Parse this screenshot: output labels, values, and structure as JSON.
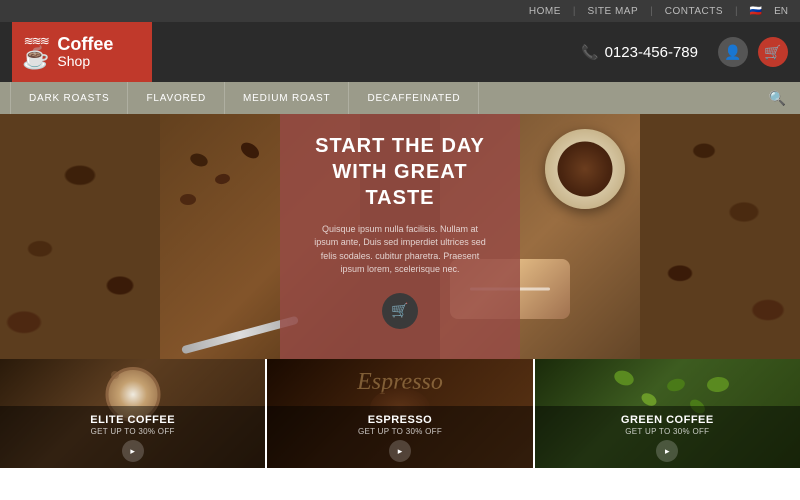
{
  "topbar": {
    "links": [
      "HOME",
      "SITE MAP",
      "CONTACTS"
    ],
    "lang_flag": "🇷🇺",
    "lang": "EN"
  },
  "header": {
    "logo_steam": "§§§",
    "logo_coffee": "Coffee",
    "logo_shop": "Shop",
    "phone_number": "0123-456-789"
  },
  "nav": {
    "items": [
      "DARK ROASTS",
      "FLAVORED",
      "MEDIUM ROAST",
      "DECAFFEINATED"
    ]
  },
  "hero": {
    "heading_line1": "START THE DAY",
    "heading_line2": "WITH GREAT TASTE",
    "subtext": "Quisque ipsum nulla facilisis. Nullam at ipsum ante, Duis sed imperdiet ultrices sed felis sodales. cubitur pharetra. Praesent ipsum lorem, scelerisque nec.",
    "cart_icon": "🛒"
  },
  "products": [
    {
      "title": "ELITE COFFEE",
      "subtitle": "GET UP TO 30% OFF",
      "bg_color": "#2a1a0a"
    },
    {
      "title": "ESPRESSO",
      "subtitle": "GET UP TO 30% OFF",
      "bg_color": "#1a0a00"
    },
    {
      "title": "GREEN COFFEE",
      "subtitle": "GET UP TO 30% OFF",
      "bg_color": "#1a2a0a"
    }
  ],
  "colors": {
    "accent_red": "#c0392b",
    "dark_bg": "#2b2b2b",
    "nav_bg": "#9b9b8a",
    "hero_card": "rgba(150,75,70,0.82)"
  }
}
